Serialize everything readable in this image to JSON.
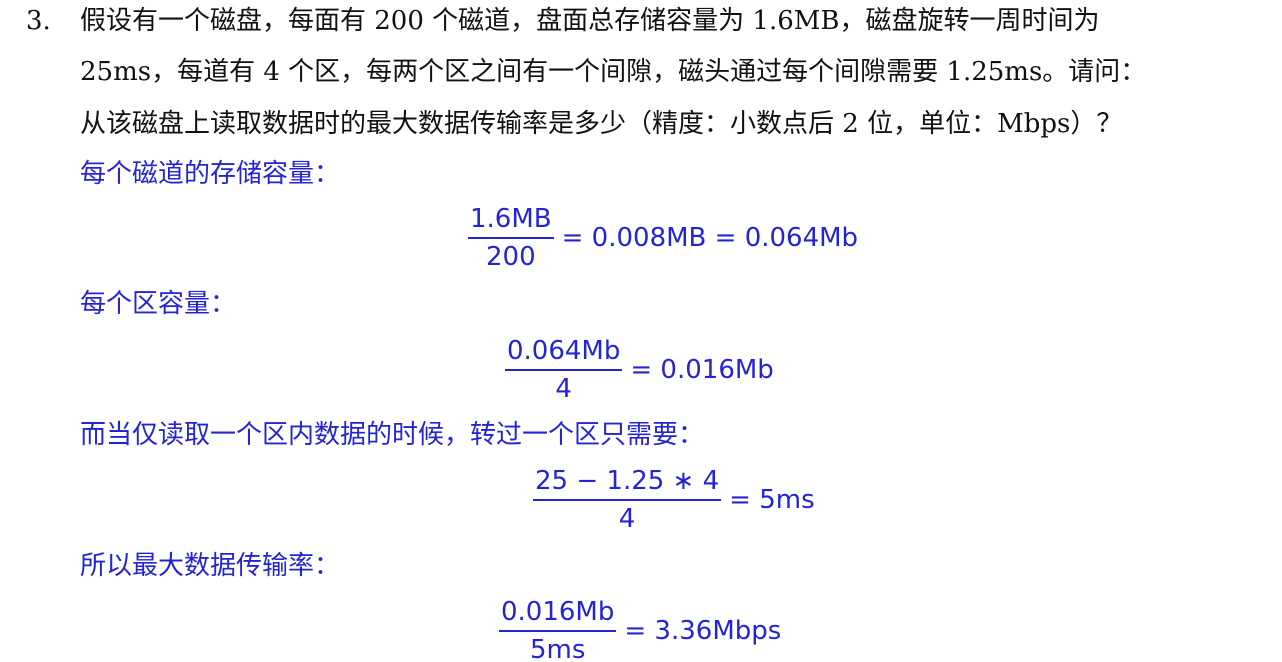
{
  "colors": {
    "question_text": "#111111",
    "solution_text": "#2424d6"
  },
  "question": {
    "number": "3.",
    "lines": [
      "假设有一个磁盘，每面有 200 个磁道，盘面总存储容量为 1.6MB，磁盘旋转一周时间为",
      "25ms，每道有 4 个区，每两个区之间有一个间隙，磁头通过每个间隙需要 1.25ms。请问：",
      "从该磁盘上读取数据时的最大数据传输率是多少（精度：小数点后 2 位，单位：Mbps）？"
    ]
  },
  "solution": {
    "step1": {
      "text": "每个磁道的存储容量：",
      "numerator": "1.6MB",
      "denominator": "200",
      "result": "= 0.008MB = 0.064Mb"
    },
    "step2": {
      "text": "每个区容量：",
      "numerator": "0.064Mb",
      "denominator": "4",
      "result": "= 0.016Mb"
    },
    "step3": {
      "text": "而当仅读取一个区内数据的时候，转过一个区只需要：",
      "numerator": "25 − 1.25 ∗ 4",
      "denominator": "4",
      "result": "= 5ms"
    },
    "step4": {
      "text": "所以最大数据传输率：",
      "numerator": "0.016Mb",
      "denominator": "5ms",
      "result": "= 3.36Mbps"
    }
  }
}
